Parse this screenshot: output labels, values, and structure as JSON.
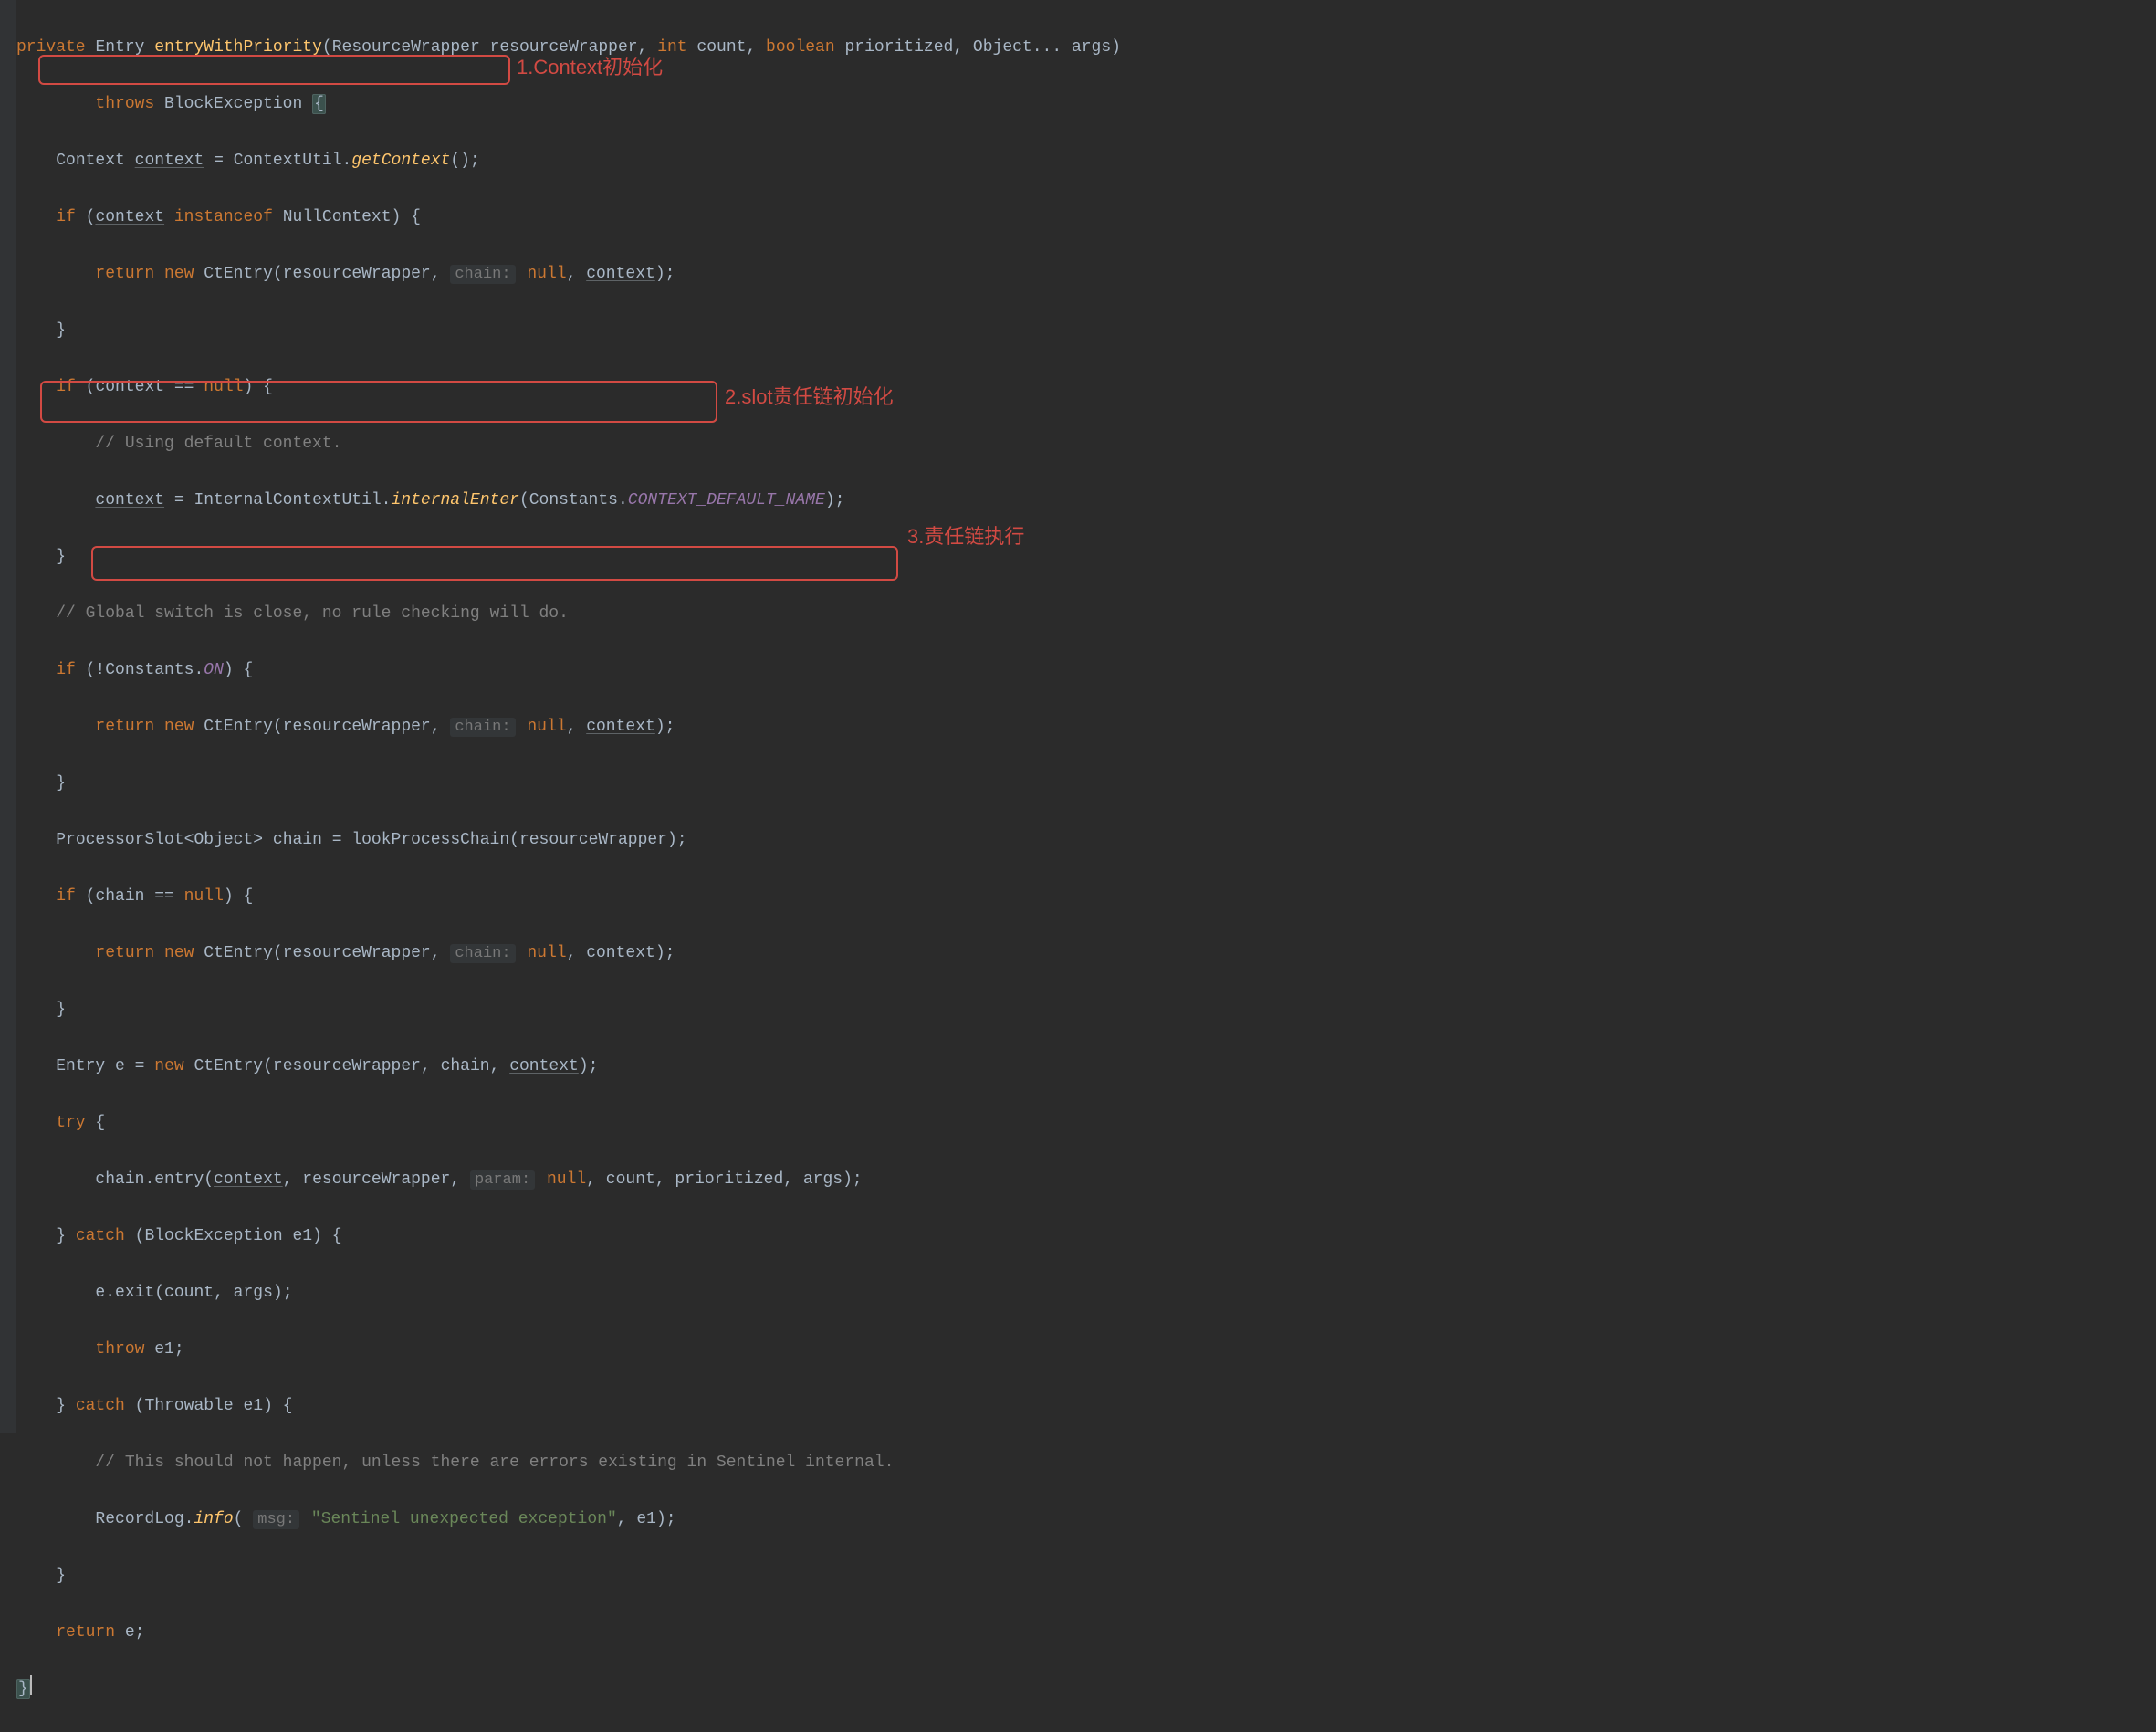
{
  "annotations": {
    "a1": "1.Context初始化",
    "a2": "2.slot责任链初始化",
    "a3": "3.责任链执行"
  },
  "hints": {
    "chain": "chain:",
    "param": "param:",
    "msg": "msg:"
  },
  "tokens": {
    "private": "private",
    "int": "int",
    "boolean": "boolean",
    "throws": "throws",
    "instanceof": "instanceof",
    "return": "return",
    "new": "new",
    "if": "if",
    "null": "null",
    "try": "try",
    "catch": "catch",
    "throw": "throw",
    "Entry": "Entry",
    "entryWithPriority": "entryWithPriority",
    "ResourceWrapper": "ResourceWrapper",
    "resourceWrapper": "resourceWrapper",
    "count": "count",
    "prioritized": "prioritized",
    "Object": "Object",
    "args": "args",
    "BlockException": "BlockException",
    "Context": "Context",
    "context": "context",
    "ContextUtil": "ContextUtil.",
    "getContext": "getContext",
    "NullContext": "NullContext",
    "CtEntry": "CtEntry",
    "commentDefault": "// Using default context.",
    "InternalContextUtil": "InternalContextUtil.",
    "internalEnter": "internalEnter",
    "Constants": "Constants",
    "CONTEXT_DEFAULT_NAME": "CONTEXT_DEFAULT_NAME",
    "commentGlobal": "// Global switch is close, no rule checking will do.",
    "ON": "ON",
    "ProcessorSlot": "ProcessorSlot",
    "chain": "chain",
    "lookProcessChain": "lookProcessChain",
    "e": "e",
    "entryCall": ".entry(",
    "e1": "e1",
    "exit": ".exit(",
    "Throwable": "Throwable",
    "commentShould": "// This should not happen, unless there are errors existing in Sentinel internal.",
    "RecordLog": "RecordLog.",
    "info": "info",
    "sentinelStr": "\"Sentinel unexpected exception\""
  }
}
